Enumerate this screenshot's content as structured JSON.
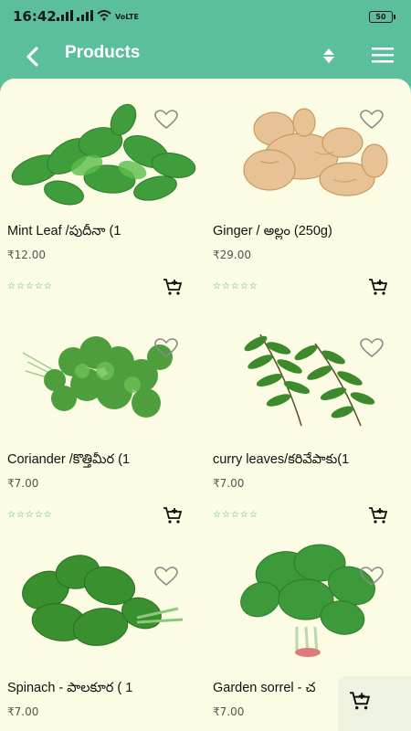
{
  "status": {
    "time": "16:42",
    "network": "VoLTE",
    "battery": "50"
  },
  "appbar": {
    "title": "Products",
    "back_icon": "back-arrow-icon",
    "sort_icon": "sort-icon",
    "menu_icon": "hamburger-menu-icon"
  },
  "products": [
    {
      "name": "Mint Leaf /పుదీనా (1",
      "price": "₹12.00",
      "stars": "☆☆☆☆☆"
    },
    {
      "name": "Ginger / అల్లం (250g)",
      "price": "₹29.00",
      "stars": "☆☆☆☆☆"
    },
    {
      "name": "Coriander /కొత్తిమీర (1",
      "price": "₹7.00",
      "stars": "☆☆☆☆☆"
    },
    {
      "name": "curry leaves/కరివేపాకు(1",
      "price": "₹7.00",
      "stars": "☆☆☆☆☆"
    },
    {
      "name": "Spinach - పాలకూర ( 1",
      "price": "₹7.00",
      "stars": ""
    },
    {
      "name": "Garden sorrel - చ",
      "price": "₹7.00",
      "stars": ""
    }
  ],
  "colors": {
    "header": "#5bbf9c",
    "background": "#fcfbe3",
    "accent": "#4aa68a"
  }
}
